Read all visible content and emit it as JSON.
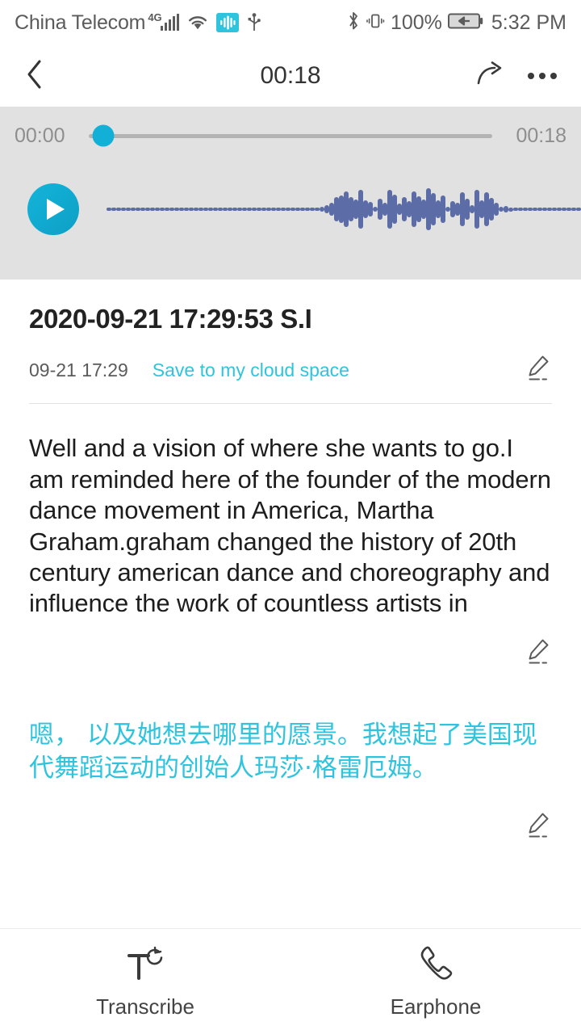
{
  "status_bar": {
    "carrier": "China Telecom",
    "network": "4G",
    "battery_percent": "100%",
    "time": "5:32 PM",
    "icons": [
      "signal-bars-icon",
      "wifi-icon",
      "voice-assistant-icon",
      "usb-icon",
      "bluetooth-icon",
      "vibrate-icon",
      "battery-charging-icon"
    ]
  },
  "nav_bar": {
    "back_icon": "chevron-left-icon",
    "title": "00:18",
    "share_icon": "share-arrow-icon",
    "more_icon": "more-dots-icon"
  },
  "player": {
    "current_time": "00:00",
    "total_time": "00:18",
    "progress_percent": 1,
    "play_icon": "play-icon",
    "accent_color": "#12b0d6",
    "panel_color": "#e1e1e1",
    "waveform_color": "#5b6ca6",
    "waveform_bars": [
      4,
      4,
      4,
      4,
      4,
      4,
      4,
      4,
      4,
      4,
      4,
      4,
      4,
      4,
      4,
      4,
      4,
      4,
      4,
      4,
      4,
      4,
      4,
      4,
      4,
      4,
      4,
      4,
      4,
      4,
      4,
      4,
      4,
      4,
      4,
      4,
      4,
      4,
      4,
      4,
      4,
      4,
      4,
      4,
      6,
      10,
      16,
      30,
      34,
      44,
      30,
      24,
      48,
      22,
      18,
      6,
      26,
      16,
      48,
      36,
      14,
      30,
      20,
      44,
      32,
      24,
      52,
      40,
      22,
      34,
      6,
      20,
      16,
      42,
      26,
      10,
      48,
      22,
      42,
      28,
      16,
      6,
      8,
      5,
      4,
      4,
      4,
      4,
      4,
      4,
      4,
      4,
      4,
      4,
      4,
      4,
      4,
      4,
      4,
      4,
      4,
      4,
      4,
      4,
      4,
      4
    ]
  },
  "recording": {
    "title": "2020-09-21 17:29:53 S.I",
    "date": "09-21 17:29",
    "cloud_link": "Save to my cloud space",
    "edit_icon": "pencil-edit-icon"
  },
  "transcript": {
    "english": "Well and a vision of where she wants to go.I am reminded here of the founder of the modern dance movement in America, Martha Graham.graham changed the history of 20th century american dance and choreography and influence the work of countless artists in",
    "chinese": "嗯， 以及她想去哪里的愿景。我想起了美国现代舞蹈运动的创始人玛莎·格雷厄姆。",
    "chinese_color": "#2ec4dd"
  },
  "bottom_bar": {
    "items": [
      {
        "label": "Transcribe",
        "icon": "transcribe-icon"
      },
      {
        "label": "Earphone",
        "icon": "earphone-icon"
      }
    ]
  }
}
